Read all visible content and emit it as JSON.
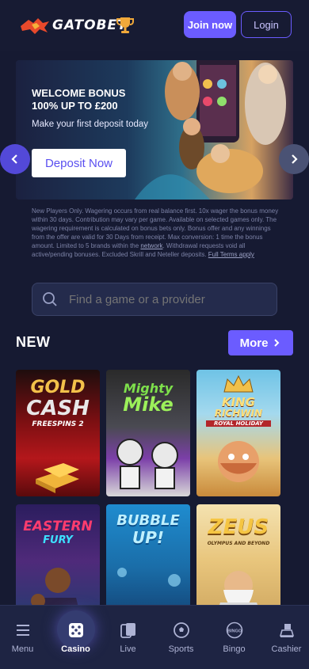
{
  "header": {
    "brand": "GATOBET",
    "join_label": "Join now",
    "login_label": "Login"
  },
  "banner": {
    "title": "WELCOME BONUS 100% UP TO £200",
    "subtitle": "Make your first deposit today",
    "cta_label": "Deposit Now",
    "prev_icon": "chevron-left",
    "next_icon": "chevron-right"
  },
  "terms": {
    "text_before": "New Players Only. Wagering occurs from real balance first. 10x wager the bonus money within 30 days. Contribution may vary per game. Available on selected games only. The wagering requirement is calculated on bonus bets only. Bonus offer and any winnings from the offer are valid for 30 Days from receipt. Max conversion: 1 time the bonus amount. Limited to 5 brands within the ",
    "network_link": "network",
    "text_after": ". Withdrawal requests void all active/pending bonuses. Excluded Skrill and Neteller deposits. ",
    "full_terms_link": "Full Terms apply"
  },
  "search": {
    "placeholder": "Find a game or a provider"
  },
  "new_section": {
    "title": "NEW",
    "more_label": "More"
  },
  "games": [
    {
      "name": "GOLD",
      "name2": "CASH",
      "name3": "FREESPINS 2"
    },
    {
      "name": "Mighty",
      "name2": "Mike"
    },
    {
      "name": "KING",
      "name2": "RICHWIN",
      "name3": "ROYAL HOLIDAY"
    },
    {
      "name": "EASTERN",
      "name2": "FURY"
    },
    {
      "name": "BUBBLE",
      "name2": "UP!"
    },
    {
      "name": "ZEUS",
      "name2": "OLYMPUS AND BEYOND"
    }
  ],
  "bottom_nav": [
    {
      "label": "Menu",
      "icon": "menu-icon"
    },
    {
      "label": "Casino",
      "icon": "dice-icon",
      "active": true
    },
    {
      "label": "Live",
      "icon": "cards-icon"
    },
    {
      "label": "Sports",
      "icon": "soccer-ball-icon"
    },
    {
      "label": "Bingo",
      "icon": "bingo-icon",
      "badge": "BINGO"
    },
    {
      "label": "Cashier",
      "icon": "cashier-icon"
    }
  ],
  "colors": {
    "background": "#161a32",
    "accent": "#6b5cff",
    "nav_bg": "#1e2443"
  }
}
